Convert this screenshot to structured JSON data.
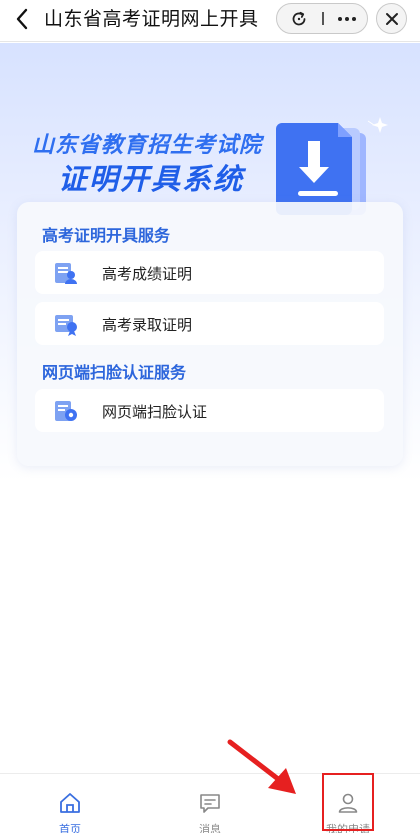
{
  "nav": {
    "title": "山东省高考证明网上开具"
  },
  "hero": {
    "line1": "山东省教育招生考试院",
    "line2": "证明开具系统"
  },
  "sections": [
    {
      "title": "高考证明开具服务",
      "items": [
        {
          "label": "高考成绩证明",
          "icon": "score-certificate-icon"
        },
        {
          "label": "高考录取证明",
          "icon": "admission-certificate-icon"
        }
      ]
    },
    {
      "title": "网页端扫脸认证服务",
      "items": [
        {
          "label": "网页端扫脸认证",
          "icon": "face-scan-icon"
        }
      ]
    }
  ],
  "tabs": [
    {
      "label": "首页",
      "icon": "home-icon",
      "active": true
    },
    {
      "label": "消息",
      "icon": "message-icon",
      "active": false
    },
    {
      "label": "我的申请",
      "icon": "user-icon",
      "active": false
    }
  ],
  "colors": {
    "accent": "#2d66dc",
    "tab_active": "#3a6fe0",
    "tab_inactive": "#888888",
    "highlight": "#e62020"
  }
}
